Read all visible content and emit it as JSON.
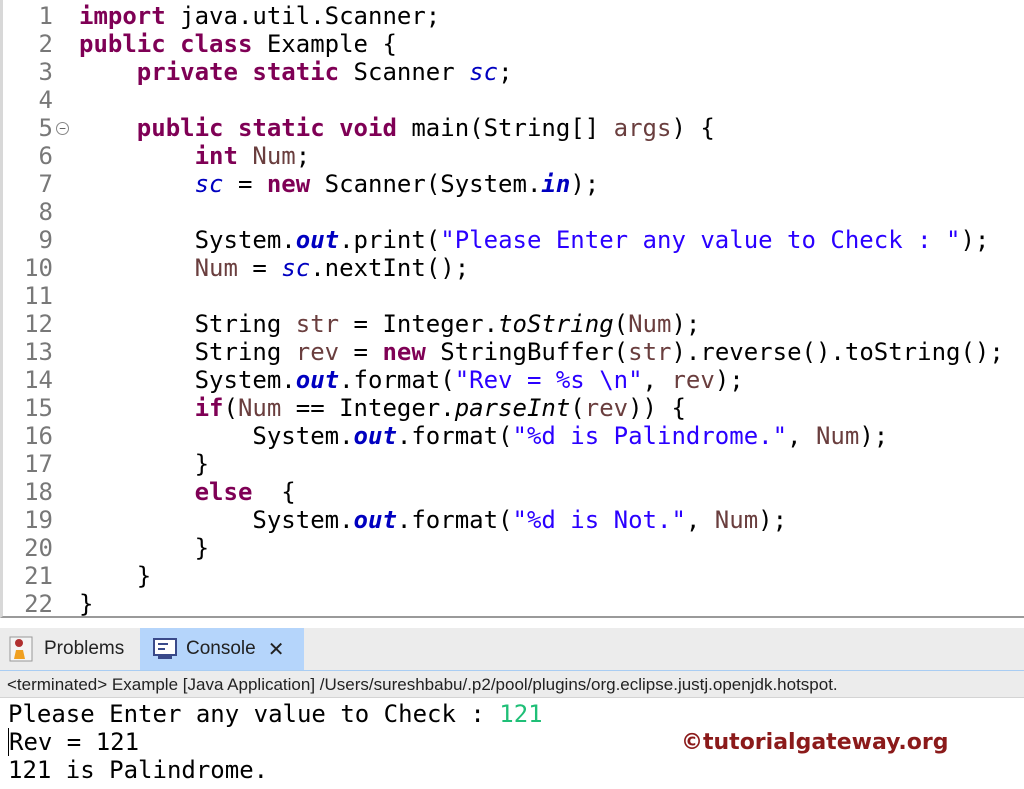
{
  "editor": {
    "fold_line": 5,
    "fold_symbol": "⊖",
    "lines": [
      [
        [
          "import",
          "kw"
        ],
        [
          " java.util.Scanner;",
          ""
        ]
      ],
      [
        [
          "public",
          "kw"
        ],
        [
          " ",
          ""
        ],
        [
          "class",
          "kw"
        ],
        [
          " Example {",
          ""
        ]
      ],
      [
        [
          "    ",
          ""
        ],
        [
          "private",
          "kw"
        ],
        [
          " ",
          ""
        ],
        [
          "static",
          "kw"
        ],
        [
          " Scanner ",
          ""
        ],
        [
          "sc",
          "fld"
        ],
        [
          ";",
          ""
        ]
      ],
      [],
      [
        [
          "    ",
          ""
        ],
        [
          "public",
          "kw"
        ],
        [
          " ",
          ""
        ],
        [
          "static",
          "kw"
        ],
        [
          " ",
          ""
        ],
        [
          "void",
          "kw"
        ],
        [
          " main(String[] ",
          ""
        ],
        [
          "args",
          "var"
        ],
        [
          ") {",
          ""
        ]
      ],
      [
        [
          "        ",
          ""
        ],
        [
          "int",
          "kw"
        ],
        [
          " ",
          ""
        ],
        [
          "Num",
          "var"
        ],
        [
          ";",
          ""
        ]
      ],
      [
        [
          "        ",
          ""
        ],
        [
          "sc",
          "fld"
        ],
        [
          " = ",
          ""
        ],
        [
          "new",
          "kw"
        ],
        [
          " Scanner(System.",
          ""
        ],
        [
          "in",
          "sfld"
        ],
        [
          ");",
          ""
        ]
      ],
      [],
      [
        [
          "        System.",
          ""
        ],
        [
          "out",
          "sfld"
        ],
        [
          ".print(",
          ""
        ],
        [
          "\"Please Enter any value to Check : \"",
          "str"
        ],
        [
          ");",
          ""
        ]
      ],
      [
        [
          "        ",
          ""
        ],
        [
          "Num",
          "var"
        ],
        [
          " = ",
          ""
        ],
        [
          "sc",
          "fld"
        ],
        [
          ".nextInt();",
          ""
        ]
      ],
      [],
      [
        [
          "        String ",
          ""
        ],
        [
          "str",
          "var"
        ],
        [
          " = Integer.",
          ""
        ],
        [
          "toString",
          "sm"
        ],
        [
          "(",
          ""
        ],
        [
          "Num",
          "var"
        ],
        [
          ");",
          ""
        ]
      ],
      [
        [
          "        String ",
          ""
        ],
        [
          "rev",
          "var"
        ],
        [
          " = ",
          ""
        ],
        [
          "new",
          "kw"
        ],
        [
          " StringBuffer(",
          ""
        ],
        [
          "str",
          "var"
        ],
        [
          ").reverse().toString();",
          ""
        ]
      ],
      [
        [
          "        System.",
          ""
        ],
        [
          "out",
          "sfld"
        ],
        [
          ".format(",
          ""
        ],
        [
          "\"Rev = %s \\n\"",
          "str"
        ],
        [
          ", ",
          ""
        ],
        [
          "rev",
          "var"
        ],
        [
          ");",
          ""
        ]
      ],
      [
        [
          "        ",
          ""
        ],
        [
          "if",
          "kw"
        ],
        [
          "(",
          ""
        ],
        [
          "Num",
          "var"
        ],
        [
          " == Integer.",
          ""
        ],
        [
          "parseInt",
          "sm"
        ],
        [
          "(",
          ""
        ],
        [
          "rev",
          "var"
        ],
        [
          ")) {",
          ""
        ]
      ],
      [
        [
          "            System.",
          ""
        ],
        [
          "out",
          "sfld"
        ],
        [
          ".format(",
          ""
        ],
        [
          "\"%d is Palindrome.\"",
          "str"
        ],
        [
          ", ",
          ""
        ],
        [
          "Num",
          "var"
        ],
        [
          ");",
          ""
        ]
      ],
      [
        [
          "        }",
          ""
        ]
      ],
      [
        [
          "        ",
          ""
        ],
        [
          "else",
          "kw"
        ],
        [
          "  {",
          ""
        ]
      ],
      [
        [
          "            System.",
          ""
        ],
        [
          "out",
          "sfld"
        ],
        [
          ".format(",
          ""
        ],
        [
          "\"%d is Not.\"",
          "str"
        ],
        [
          ", ",
          ""
        ],
        [
          "Num",
          "var"
        ],
        [
          ");",
          ""
        ]
      ],
      [
        [
          "        }",
          ""
        ]
      ],
      [
        [
          "    }",
          ""
        ]
      ],
      [
        [
          "}",
          ""
        ]
      ]
    ]
  },
  "tabs": {
    "problems": "Problems",
    "console": "Console",
    "close_symbol": "✕"
  },
  "console": {
    "header": "<terminated> Example [Java Application] /Users/sureshbabu/.p2/pool/plugins/org.eclipse.justj.openjdk.hotspot.",
    "prompt": "Please Enter any value to Check : ",
    "input": "121",
    "line2": "Rev = 121",
    "line3": "121 is Palindrome."
  },
  "watermark": "©tutorialgateway.org",
  "colors": {
    "keyword": "#7f0055",
    "string": "#2a00ff",
    "field": "#0000c0",
    "input": "#1fbf77",
    "watermark": "#8b1a1a"
  }
}
